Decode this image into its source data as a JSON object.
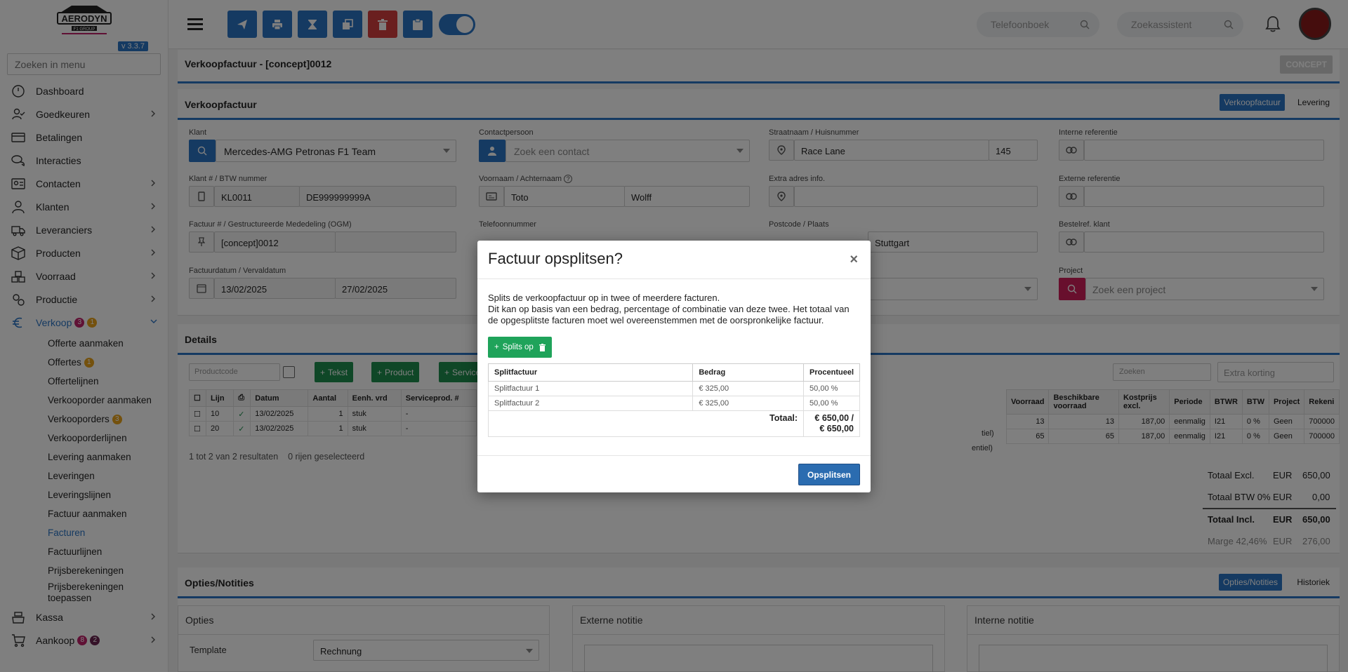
{
  "app": {
    "version": "v 3.3.7",
    "brand_primary": "#2b74c4"
  },
  "sidebar": {
    "search_placeholder": "Zoeken in menu",
    "items": [
      {
        "label": "Dashboard",
        "icon": "dashboard-icon"
      },
      {
        "label": "Goedkeuren",
        "icon": "approve-icon",
        "chevron": true
      },
      {
        "label": "Betalingen",
        "icon": "payments-icon"
      },
      {
        "label": "Interacties",
        "icon": "chat-icon"
      },
      {
        "label": "Contacten",
        "icon": "contacts-icon",
        "chevron": true
      },
      {
        "label": "Klanten",
        "icon": "customers-icon",
        "chevron": true
      },
      {
        "label": "Leveranciers",
        "icon": "truck-icon",
        "chevron": true
      },
      {
        "label": "Producten",
        "icon": "box-icon",
        "chevron": true
      },
      {
        "label": "Voorraad",
        "icon": "stock-icon",
        "chevron": true
      },
      {
        "label": "Productie",
        "icon": "production-icon",
        "chevron": true
      }
    ],
    "verkoop": {
      "label": "Verkoop",
      "badge_red": "3",
      "badge_orange": "1"
    },
    "subitems": {
      "offerte_aanmaken": "Offerte aanmaken",
      "offertes": "Offertes",
      "offertes_badge": "1",
      "offertelijnen": "Offertelijnen",
      "verkooporder_aanmaken": "Verkooporder aanmaken",
      "verkooporders": "Verkooporders",
      "verkooporders_badge": "3",
      "verkooporderlijnen": "Verkooporderlijnen",
      "levering_aanmaken": "Levering aanmaken",
      "leveringen": "Leveringen",
      "leveringslijnen": "Leveringslijnen",
      "factuur_aanmaken": "Factuur aanmaken",
      "facturen": "Facturen",
      "factuurlijnen": "Factuurlijnen",
      "prijsberekeningen": "Prijsberekeningen",
      "prijsberekeningen_toepassen": "Prijsberekeningen toepassen"
    },
    "kassa": "Kassa",
    "aankoop": {
      "label": "Aankoop",
      "badge_red": "8",
      "badge_dark": "2"
    }
  },
  "topbar": {
    "phonebook_placeholder": "Telefoonboek",
    "assistant_placeholder": "Zoekassistent"
  },
  "header": {
    "title": "Verkoopfactuur - [concept]0012",
    "status": "CONCEPT"
  },
  "invoice": {
    "title": "Verkoopfactuur",
    "tab_active": "Verkoopfactuur",
    "tab_other": "Levering",
    "labels": {
      "klant": "Klant",
      "contactpersoon": "Contactpersoon",
      "straat": "Straatnaam / Huisnummer",
      "interne_ref": "Interne referentie",
      "klantnr": "Klant # / BTW nummer",
      "naam": "Voornaam / Achternaam",
      "extra_adres": "Extra adres info.",
      "externe_ref": "Externe referentie",
      "factuurnr": "Factuur # / Gestructureerde Mededeling (OGM)",
      "telefoon": "Telefoonnummer",
      "postcode": "Postcode / Plaats",
      "bestelref": "Bestelref. klant",
      "datum": "Factuurdatum / Vervaldatum",
      "project": "Project"
    },
    "klant": "Mercedes-AMG Petronas F1 Team",
    "contact_placeholder": "Zoek een contact",
    "straat": "Race Lane",
    "huisnummer": "145",
    "klantnr": "KL0011",
    "btw": "DE999999999A",
    "voornaam": "Toto",
    "achternaam": "Wolff",
    "factuurnr": "[concept]0012",
    "plaats": "Stuttgart",
    "factuurdatum": "13/02/2025",
    "vervaldatum": "27/02/2025",
    "project_placeholder": "Zoek een project"
  },
  "details": {
    "title": "Details",
    "productcode_placeholder": "Productcode",
    "btn_tekst": "Tekst",
    "btn_product": "Product",
    "btn_service": "Service",
    "search_placeholder": "Zoeken",
    "korting_placeholder": "Extra korting",
    "left_columns": [
      "Lijn",
      "Datum",
      "Aantal",
      "Eenh. vrd",
      "Serviceprod. #"
    ],
    "right_columns": [
      "Voorraad",
      "Beschikbare voorraad",
      "Kostprijs excl.",
      "Periode",
      "BTWR",
      "BTW",
      "Project",
      "Rekeni"
    ],
    "rows": [
      {
        "lijn": "10",
        "datum": "13/02/2025",
        "aantal": "1",
        "eenh": "stuk",
        "serv": "-",
        "trunc": "tiel)",
        "voorraad": "13",
        "beschikbaar": "13",
        "kostprijs": "187,00",
        "periode": "eenmalig",
        "btwr": "I21",
        "btw": "0 %",
        "project": "Geen",
        "rekening": "700000"
      },
      {
        "lijn": "20",
        "datum": "13/02/2025",
        "aantal": "1",
        "eenh": "stuk",
        "serv": "-",
        "trunc": "entiel)",
        "voorraad": "65",
        "beschikbaar": "65",
        "kostprijs": "187,00",
        "periode": "eenmalig",
        "btwr": "I21",
        "btw": "0 %",
        "project": "Geen",
        "rekening": "700000"
      }
    ],
    "results": "1 tot 2 van 2 resultaten",
    "selected": "0 rijen geselecteerd",
    "totals": [
      {
        "label": "Totaal Excl.",
        "cur": "EUR",
        "value": "650,00"
      },
      {
        "label": "Totaal BTW 0%",
        "cur": "EUR",
        "value": "0,00"
      },
      {
        "label": "Totaal Incl.",
        "cur": "EUR",
        "value": "650,00"
      },
      {
        "label": "Marge 42,46%",
        "cur": "EUR",
        "value": "276,00"
      }
    ]
  },
  "notes": {
    "title": "Opties/Notities",
    "tab_active": "Opties/Notities",
    "tab_other": "Historiek",
    "opties": "Opties",
    "template_label": "Template",
    "template_value": "Rechnung",
    "externe": "Externe notitie",
    "interne": "Interne notitie"
  },
  "modal": {
    "title": "Factuur opsplitsen?",
    "close": "×",
    "line1": "Splits de verkoopfactuur op in twee of meerdere facturen.",
    "line2": "Dit kan op basis van een bedrag, percentage of combinatie van deze twee. Het totaal van de opgesplitste facturen moet wel overeenstemmen met de oorspronkelijke factuur.",
    "split_button": "Splits op",
    "columns": [
      "Splitfactuur",
      "Bedrag",
      "Procentueel"
    ],
    "rows": [
      {
        "name": "Splitfactuur 1",
        "bedrag": "€ 325,00",
        "procent": "50,00 %"
      },
      {
        "name": "Splitfactuur 2",
        "bedrag": "€ 325,00",
        "procent": "50,00 %"
      }
    ],
    "total_label": "Totaal:",
    "total_value": "€ 650,00 / € 650,00",
    "submit": "Opsplitsen"
  }
}
